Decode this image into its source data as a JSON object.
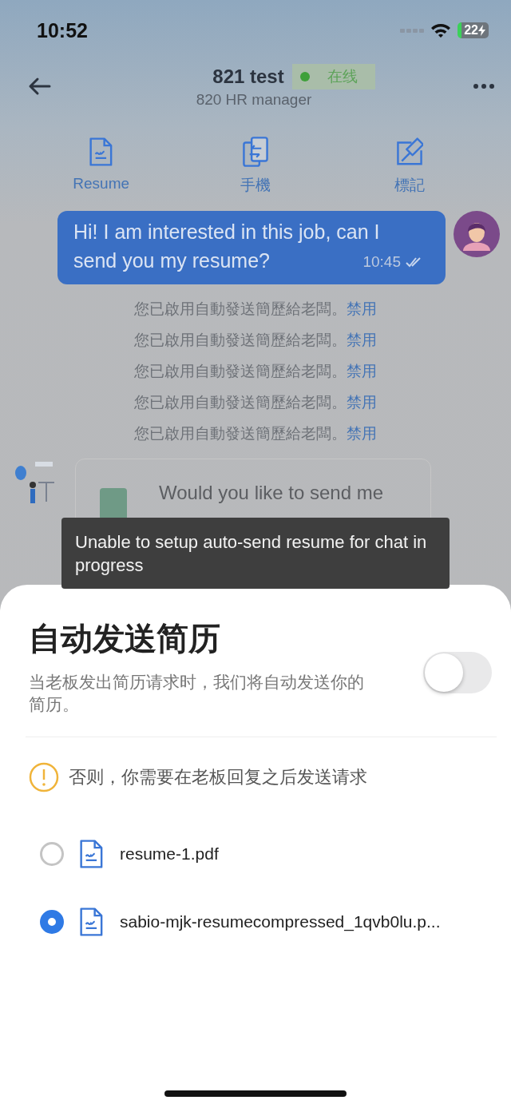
{
  "status_bar": {
    "time": "10:52",
    "battery": "22"
  },
  "header": {
    "title": "821 test",
    "status": "在线",
    "subtitle": "820 HR manager"
  },
  "actions": [
    {
      "kind": "resume",
      "label": "Resume"
    },
    {
      "kind": "phone",
      "label": "手機"
    },
    {
      "kind": "mark",
      "label": "標記"
    }
  ],
  "messages": [
    {
      "text": "Hi! I am interested in this job, can I send you my resume?",
      "time": "10:45",
      "read": true
    }
  ],
  "system_notices": [
    {
      "text": "您已啟用自動發送簡歷給老闆。",
      "action": "禁用"
    },
    {
      "text": "您已啟用自動發送簡歷給老闆。",
      "action": "禁用"
    },
    {
      "text": "您已啟用自動發送簡歷給老闆。",
      "action": "禁用"
    },
    {
      "text": "您已啟用自動發送簡歷給老闆。",
      "action": "禁用"
    },
    {
      "text": "您已啟用自動發送簡歷給老闆。",
      "action": "禁用"
    }
  ],
  "card": {
    "text": "Would you like to send me"
  },
  "toast": {
    "text": "Unable to setup auto-send resume for chat in progress"
  },
  "sheet": {
    "title": "自动发送简历",
    "description": "当老板发出简历请求时，我们将自动发送你的简历。",
    "toggle": {
      "on": false
    },
    "warning": "否则，你需要在老板回复之后发送请求",
    "files": [
      {
        "name": "resume-1.pdf",
        "selected": false
      },
      {
        "name": "sabio-mjk-resumecompressed_1qvb0lu.p...",
        "selected": true
      }
    ]
  }
}
